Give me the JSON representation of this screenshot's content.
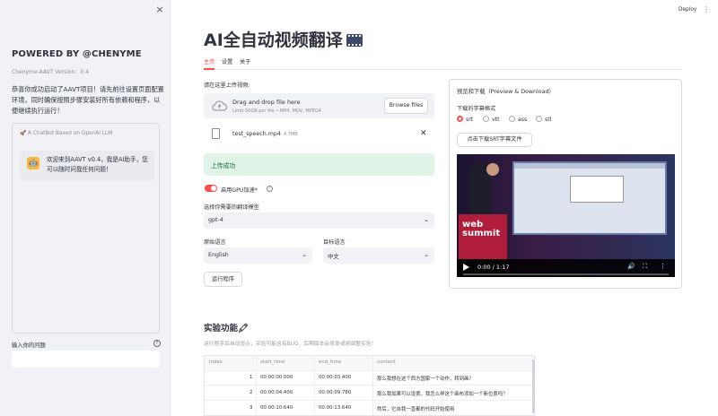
{
  "sidebar": {
    "close": "×",
    "title": "POWERED BY @CHENYME",
    "version": "Chenyme-AAVT Version：0.4",
    "description": "恭喜你成功启动了AAVT项目！请先前往设置页面配置环境，同时确保按照步骤安装好所有依赖和程序，以便继续执行运行！",
    "chat": {
      "caption": "🚀 A ChatBot Based on OpenAI LLM",
      "avatar": "🤖",
      "message": "欢迎来到AAVT v0.4，我是AI助手，您可以随时问我任何问题！"
    },
    "input_label": "输入你的问题",
    "input_help": "?"
  },
  "topbar": {
    "deploy": "Deploy",
    "menu": "⋮"
  },
  "page": {
    "title": "AI全自动视频翻译",
    "tabs": [
      "主页",
      "设置",
      "关于"
    ]
  },
  "main": {
    "upload_label": "请在这里上传视频:",
    "drop_title": "Drag and drop file here",
    "drop_limit": "Limit 50GB per file • MP4, MOV, MPEG4",
    "browse": "Browse files",
    "file_name": "test_speech.mp4",
    "file_size": "4.7MB",
    "file_remove": "✕",
    "success": "上传成功",
    "gpu_toggle": "启用GPU加速*",
    "help": "?",
    "translate_model_label": "选择你需要的翻译模型",
    "translate_model_value": "gpt-4",
    "source_lang_label": "原始语言",
    "source_lang_value": "English",
    "target_lang_label": "目标语言",
    "target_lang_value": "中文",
    "chevron": "⌄",
    "run": "运行程序"
  },
  "preview": {
    "title": "预览和下载（Preview & Download）",
    "format_label": "下载的字幕格式",
    "formats": [
      "srt",
      "vtt",
      "ass",
      "stl"
    ],
    "selected_format": "srt",
    "download": "点击下载SRT字幕文件",
    "video_logo": "web summit",
    "video_time": "0:00 / 1:17",
    "volume": "🔊",
    "fullscreen": "⛶",
    "more": "⋮"
  },
  "experimental": {
    "title": "实验功能",
    "emoji": "🖍",
    "caption": "运行程序后自动显示，实验可能含有BUG，后期版本会修复或将调整实验！",
    "columns": [
      "index",
      "start_time",
      "end_time",
      "content"
    ],
    "rows": [
      [
        "1",
        "00:00:00.000",
        "00:00:03.400",
        "那么我想在这个西方国家一个动作，转到画？"
      ],
      [
        "2",
        "00:00:04.400",
        "00:00:09.780",
        "那么我如果可以设置，我怎么样这个画布添加一个新位置吗？"
      ],
      [
        "3",
        "00:00:10.640",
        "00:00:13.640",
        "然后，它自我一直都的代码开始使用"
      ]
    ]
  }
}
